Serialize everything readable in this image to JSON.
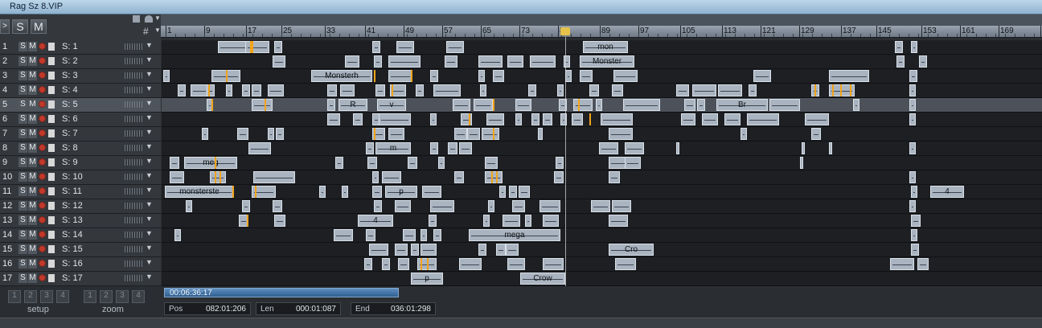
{
  "window": {
    "title": "Rag Sz 8.VIP"
  },
  "toolbar": {
    "solo_label": "S",
    "mute_label": "M",
    "snap_icon": "grid-icon"
  },
  "ruler": {
    "labels": [
      "1",
      "9",
      "17",
      "25",
      "33",
      "41",
      "49",
      "57",
      "65",
      "73",
      "81",
      "89",
      "97",
      "105",
      "113",
      "121",
      "129",
      "137",
      "145",
      "153",
      "161",
      "169",
      "1"
    ]
  },
  "tracks": [
    {
      "num": "1",
      "name": "S: 1"
    },
    {
      "num": "2",
      "name": "S: 2"
    },
    {
      "num": "3",
      "name": "S: 3"
    },
    {
      "num": "4",
      "name": "S: 4"
    },
    {
      "num": "5",
      "name": "S: 5"
    },
    {
      "num": "6",
      "name": "S: 6"
    },
    {
      "num": "7",
      "name": "S: 7"
    },
    {
      "num": "8",
      "name": "S: 8"
    },
    {
      "num": "9",
      "name": "S: 9"
    },
    {
      "num": "10",
      "name": "S: 10"
    },
    {
      "num": "11",
      "name": "S: 11"
    },
    {
      "num": "12",
      "name": "S: 12"
    },
    {
      "num": "13",
      "name": "S: 13"
    },
    {
      "num": "14",
      "name": "S: 14"
    },
    {
      "num": "15",
      "name": "S: 15"
    },
    {
      "num": "16",
      "name": "S: 16"
    },
    {
      "num": "17",
      "name": "S: 17"
    }
  ],
  "track_buttons": {
    "solo": "S",
    "mute": "M"
  },
  "clip_labels": [
    "mon",
    "Monster",
    "Monsterh",
    "R",
    "v",
    "Br",
    "m",
    "meg",
    "monsterste",
    "p",
    "4",
    "mega",
    "Cro",
    "Crow"
  ],
  "transport": {
    "time_display": "00:06:36:17",
    "pos_label": "Pos",
    "pos_value": "082:01:206",
    "len_label": "Len",
    "len_value": "000:01:087",
    "end_label": "End",
    "end_value": "036:01:298"
  },
  "setup": {
    "label": "setup",
    "buttons": [
      "1",
      "2",
      "3",
      "4"
    ]
  },
  "zoom": {
    "label": "zoom",
    "buttons": [
      "1",
      "2",
      "3",
      "4"
    ]
  }
}
